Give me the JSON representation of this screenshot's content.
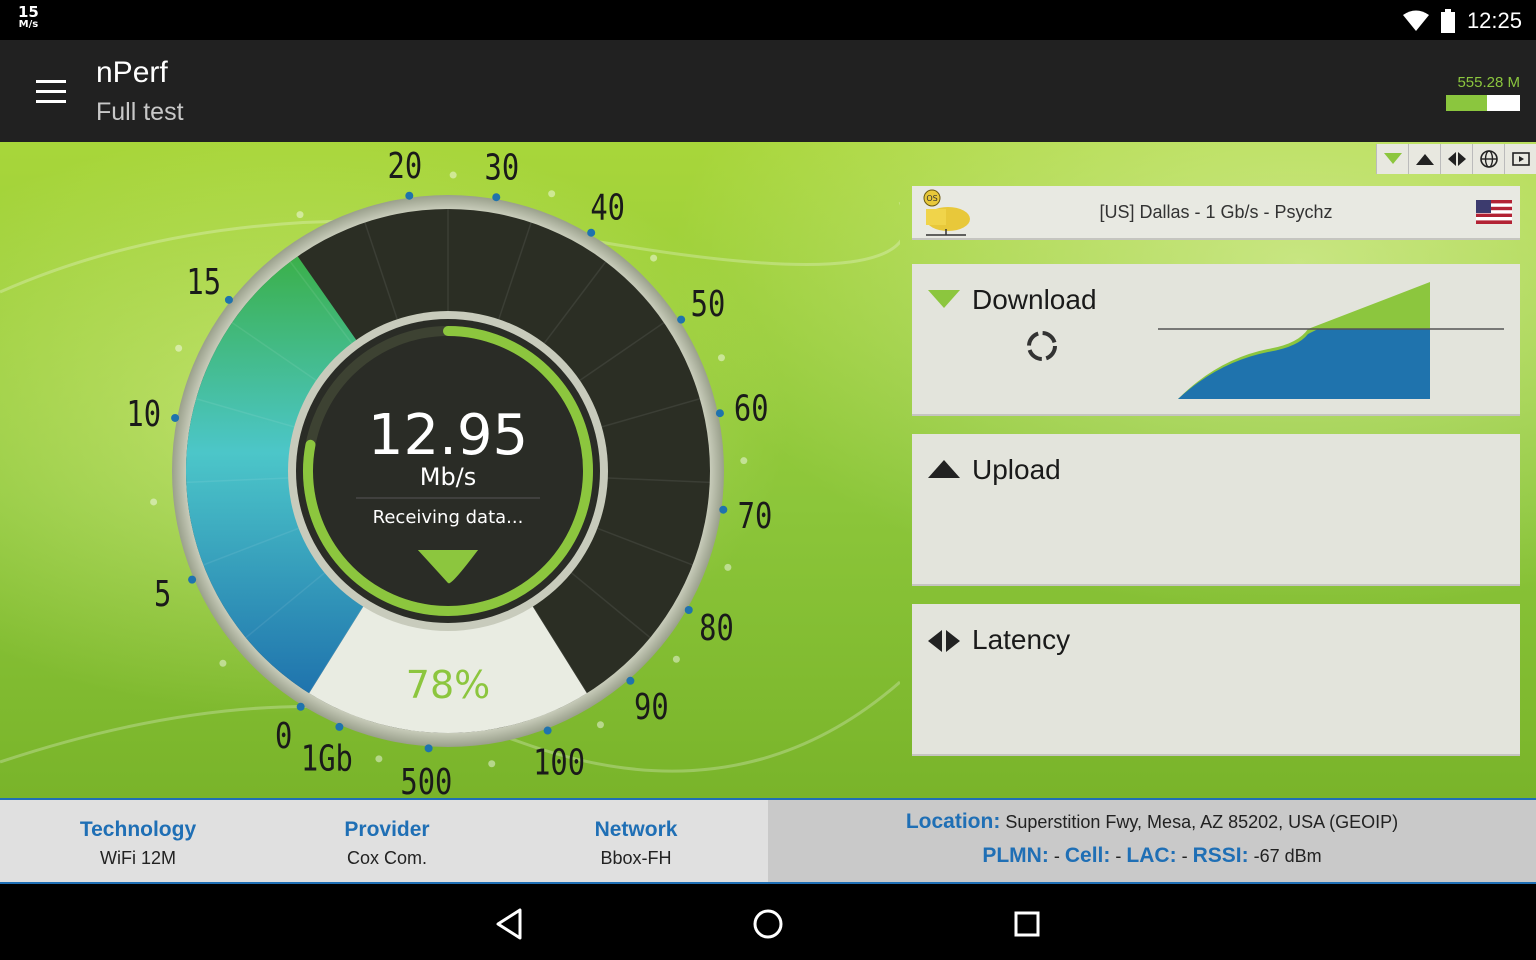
{
  "status_bar": {
    "speed_value": "15",
    "speed_unit": "M/s",
    "time": "12:25",
    "icons": [
      "wifi-icon",
      "battery-icon"
    ]
  },
  "app_bar": {
    "title": "nPerf",
    "subtitle": "Full test",
    "data_usage": "555.28 M",
    "data_usage_fraction": 0.55,
    "menu_icon": "hamburger-menu-icon"
  },
  "gauge": {
    "speed_value": "12.95",
    "speed_unit": "Mb/s",
    "status": "Receiving data...",
    "progress_label": "78%",
    "progress_fraction": 0.78,
    "scale_labels": [
      "0",
      "5",
      "10",
      "15",
      "20",
      "30",
      "40",
      "50",
      "60",
      "70",
      "80",
      "90",
      "100",
      "500",
      "1Gb"
    ],
    "accent_color": "#8cc63e"
  },
  "tabs": [
    {
      "icon": "download-icon"
    },
    {
      "icon": "upload-icon"
    },
    {
      "icon": "latency-icon"
    },
    {
      "icon": "globe-icon"
    },
    {
      "icon": "browse-icon"
    }
  ],
  "server": {
    "name": "[US] Dallas - 1 Gb/s - Psychz",
    "icon_badge": "OS",
    "flag": "us-flag-icon"
  },
  "cards": {
    "download": {
      "label": "Download"
    },
    "upload": {
      "label": "Upload"
    },
    "latency": {
      "label": "Latency"
    }
  },
  "info": {
    "technology": {
      "label": "Technology",
      "value": "WiFi 12M"
    },
    "provider": {
      "label": "Provider",
      "value": "Cox Com."
    },
    "network": {
      "label": "Network",
      "value": "Bbox-FH"
    },
    "location_label": "Location:",
    "location_value": "Superstition Fwy, Mesa, AZ 85202, USA (GEOIP)",
    "plmn_label": "PLMN:",
    "plmn_value": "-",
    "cell_label": "Cell:",
    "cell_value": "-",
    "lac_label": "LAC:",
    "lac_value": "-",
    "rssi_label": "RSSI:",
    "rssi_value": "-67 dBm"
  },
  "nav": {
    "back": "back-icon",
    "home": "home-icon",
    "recents": "recents-icon"
  },
  "colors": {
    "brand_green": "#8cc63e",
    "link_blue": "#1f6fb5",
    "download_blue": "#1f73ad"
  }
}
